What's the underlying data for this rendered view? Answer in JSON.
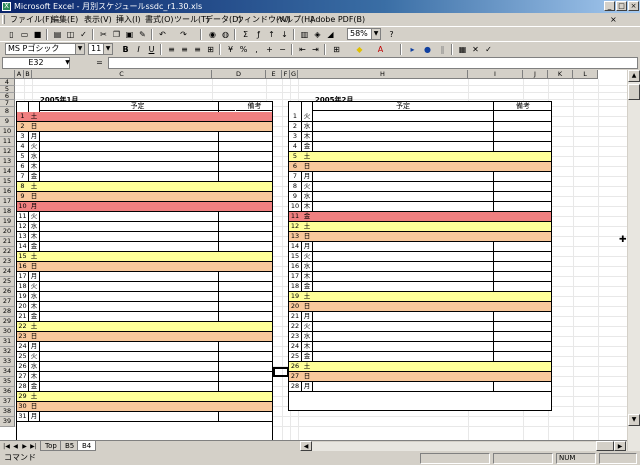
{
  "window": {
    "title": "Microsoft Excel - 月別スケジュールssdc_r1.30.xls"
  },
  "menu": [
    {
      "label": "ファイル(F)"
    },
    {
      "label": "編集(E)"
    },
    {
      "label": "表示(V)"
    },
    {
      "label": "挿入(I)"
    },
    {
      "label": "書式(O)"
    },
    {
      "label": "ツール(T)"
    },
    {
      "label": "データ(D)"
    },
    {
      "label": "ウィンドウ(W)"
    },
    {
      "label": "ヘルプ(H)"
    },
    {
      "label": "Adobe PDF(B)"
    }
  ],
  "toolbar": {
    "zoom": "58%",
    "font_name": "MS Pゴシック",
    "font_size": "11"
  },
  "formula_bar": {
    "name_box": "E32",
    "fx": "=",
    "content": ""
  },
  "columns": [
    "A",
    "B",
    "C",
    "D",
    "E",
    "F",
    "G",
    "H",
    "I",
    "J",
    "K",
    "L"
  ],
  "rows": [
    "4",
    "5",
    "6",
    "7",
    "8",
    "9",
    "10",
    "11",
    "12",
    "13",
    "14",
    "15",
    "16",
    "17",
    "18",
    "19",
    "20",
    "21",
    "22",
    "23",
    "24",
    "25",
    "26",
    "27",
    "28",
    "29",
    "30",
    "31",
    "32",
    "33",
    "34",
    "35",
    "36",
    "37",
    "38",
    "39"
  ],
  "colors": {
    "red": "#f08080",
    "orange": "#f8c89c",
    "yellow": "#ffff99"
  },
  "left_calendar": {
    "title": "2005年1月",
    "plan_header": "予定",
    "note_header": "備考",
    "days": [
      {
        "d": "1",
        "w": "土",
        "c": "red"
      },
      {
        "d": "2",
        "w": "日",
        "c": "orange"
      },
      {
        "d": "3",
        "w": "月",
        "c": ""
      },
      {
        "d": "4",
        "w": "火",
        "c": ""
      },
      {
        "d": "5",
        "w": "水",
        "c": ""
      },
      {
        "d": "6",
        "w": "木",
        "c": ""
      },
      {
        "d": "7",
        "w": "金",
        "c": ""
      },
      {
        "d": "8",
        "w": "土",
        "c": "yellow"
      },
      {
        "d": "9",
        "w": "日",
        "c": "orange"
      },
      {
        "d": "10",
        "w": "月",
        "c": "red"
      },
      {
        "d": "11",
        "w": "火",
        "c": ""
      },
      {
        "d": "12",
        "w": "水",
        "c": ""
      },
      {
        "d": "13",
        "w": "木",
        "c": ""
      },
      {
        "d": "14",
        "w": "金",
        "c": ""
      },
      {
        "d": "15",
        "w": "土",
        "c": "yellow"
      },
      {
        "d": "16",
        "w": "日",
        "c": "orange"
      },
      {
        "d": "17",
        "w": "月",
        "c": ""
      },
      {
        "d": "18",
        "w": "火",
        "c": ""
      },
      {
        "d": "19",
        "w": "水",
        "c": ""
      },
      {
        "d": "20",
        "w": "木",
        "c": ""
      },
      {
        "d": "21",
        "w": "金",
        "c": ""
      },
      {
        "d": "22",
        "w": "土",
        "c": "yellow"
      },
      {
        "d": "23",
        "w": "日",
        "c": "orange"
      },
      {
        "d": "24",
        "w": "月",
        "c": ""
      },
      {
        "d": "25",
        "w": "火",
        "c": ""
      },
      {
        "d": "26",
        "w": "水",
        "c": ""
      },
      {
        "d": "27",
        "w": "木",
        "c": ""
      },
      {
        "d": "28",
        "w": "金",
        "c": ""
      },
      {
        "d": "29",
        "w": "土",
        "c": "yellow"
      },
      {
        "d": "30",
        "w": "日",
        "c": "orange"
      },
      {
        "d": "31",
        "w": "月",
        "c": ""
      }
    ]
  },
  "right_calendar": {
    "title": "2005年2月",
    "plan_header": "予定",
    "note_header": "備考",
    "days": [
      {
        "d": "1",
        "w": "火",
        "c": ""
      },
      {
        "d": "2",
        "w": "水",
        "c": ""
      },
      {
        "d": "3",
        "w": "木",
        "c": ""
      },
      {
        "d": "4",
        "w": "金",
        "c": ""
      },
      {
        "d": "5",
        "w": "土",
        "c": "yellow"
      },
      {
        "d": "6",
        "w": "日",
        "c": "orange"
      },
      {
        "d": "7",
        "w": "月",
        "c": ""
      },
      {
        "d": "8",
        "w": "火",
        "c": ""
      },
      {
        "d": "9",
        "w": "水",
        "c": ""
      },
      {
        "d": "10",
        "w": "木",
        "c": ""
      },
      {
        "d": "11",
        "w": "金",
        "c": "red"
      },
      {
        "d": "12",
        "w": "土",
        "c": "yellow"
      },
      {
        "d": "13",
        "w": "日",
        "c": "orange"
      },
      {
        "d": "14",
        "w": "月",
        "c": ""
      },
      {
        "d": "15",
        "w": "火",
        "c": ""
      },
      {
        "d": "16",
        "w": "水",
        "c": ""
      },
      {
        "d": "17",
        "w": "木",
        "c": ""
      },
      {
        "d": "18",
        "w": "金",
        "c": ""
      },
      {
        "d": "19",
        "w": "土",
        "c": "yellow"
      },
      {
        "d": "20",
        "w": "日",
        "c": "orange"
      },
      {
        "d": "21",
        "w": "月",
        "c": ""
      },
      {
        "d": "22",
        "w": "火",
        "c": ""
      },
      {
        "d": "23",
        "w": "水",
        "c": ""
      },
      {
        "d": "24",
        "w": "木",
        "c": ""
      },
      {
        "d": "25",
        "w": "金",
        "c": ""
      },
      {
        "d": "26",
        "w": "土",
        "c": "yellow"
      },
      {
        "d": "27",
        "w": "日",
        "c": "orange"
      },
      {
        "d": "28",
        "w": "月",
        "c": ""
      }
    ]
  },
  "sheet_tabs": [
    {
      "label": "Top",
      "active": false
    },
    {
      "label": "B5",
      "active": false
    },
    {
      "label": "B4",
      "active": true
    }
  ],
  "status": {
    "mode": "コマンド",
    "num": "NUM"
  }
}
